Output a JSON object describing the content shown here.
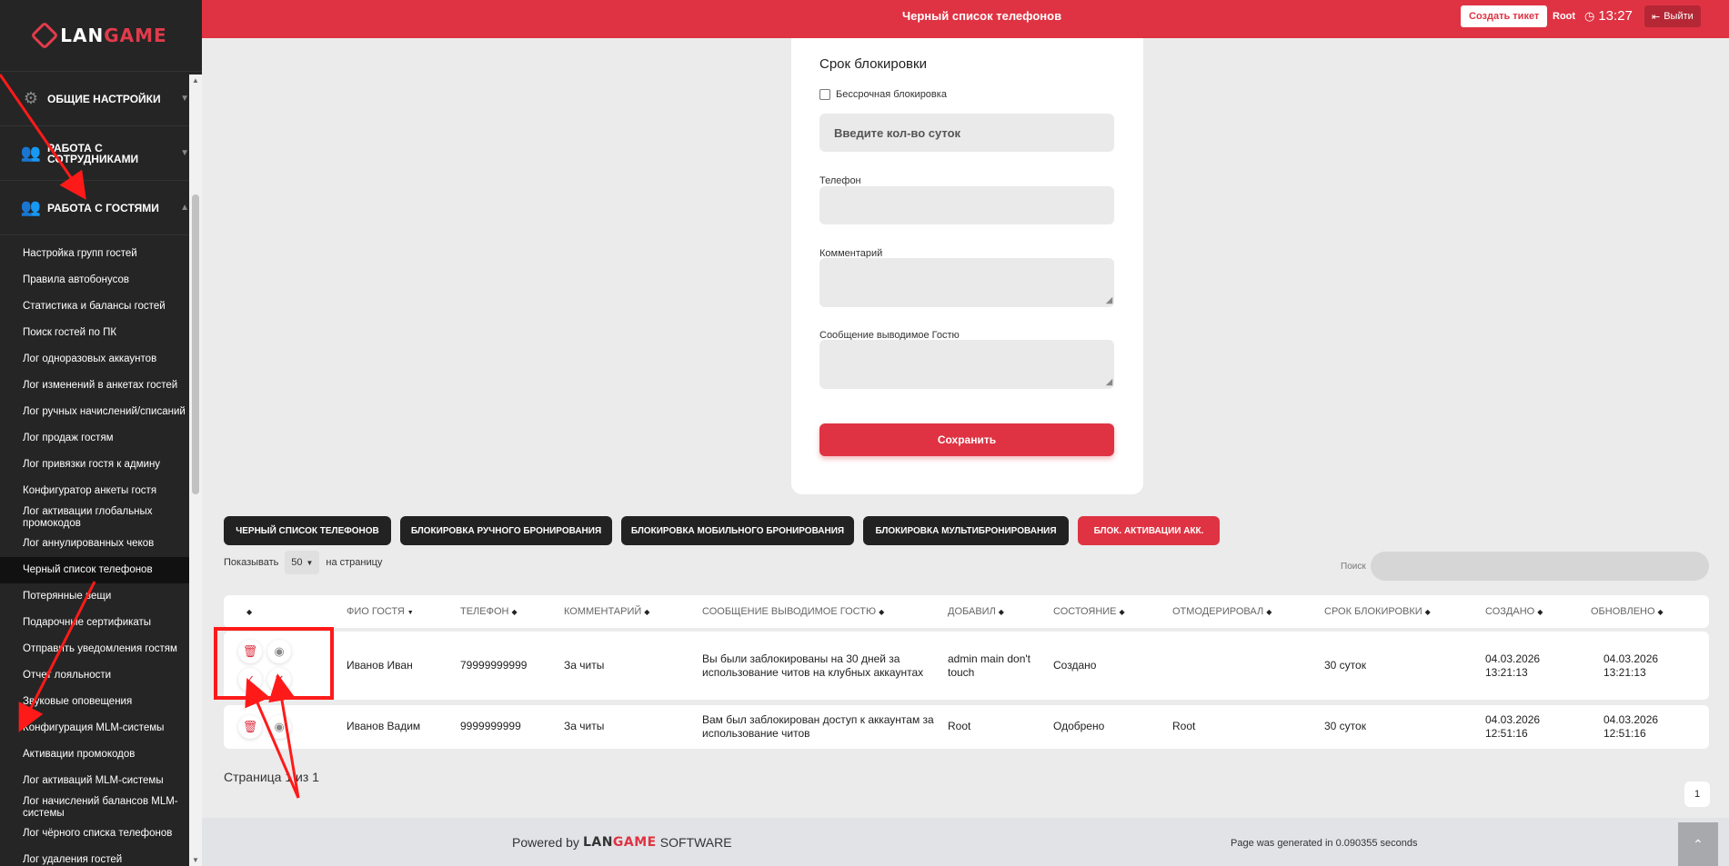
{
  "app": {
    "logo_main": "LAN",
    "logo_accent": "GAME"
  },
  "header": {
    "title": "Черный список телефонов",
    "ticket_button": "Создать тикет",
    "user": "Root",
    "time": "13:27",
    "logout": "Выйти"
  },
  "sidebar": {
    "sections": [
      {
        "label": "Общие настройки",
        "icon": "gear-icon"
      },
      {
        "label": "Работа с сотрудниками",
        "icon": "users-icon"
      },
      {
        "label": "Работа с гостями",
        "icon": "users-icon"
      }
    ],
    "items": [
      "Настройка групп гостей",
      "Правила автобонусов",
      "Статистика и балансы гостей",
      "Поиск гостей по ПК",
      "Лог одноразовых аккаунтов",
      "Лог изменений в анкетах гостей",
      "Лог ручных начислений/списаний",
      "Лог продаж гостям",
      "Лог привязки гостя к админу",
      "Конфигуратор анкеты гостя",
      "Лог активации глобальных промокодов",
      "Лог аннулированных чеков",
      "Черный список телефонов",
      "Потерянные вещи",
      "Подарочные сертификаты",
      "Отправить уведомления гостям",
      "Отчет лояльности",
      "Звуковые оповещения",
      "Конфигурация MLM-системы",
      "Активации промокодов",
      "Лог активаций MLM-системы",
      "Лог начислений балансов MLM-системы",
      "Лог чёрного списка телефонов",
      "Лог удаления гостей"
    ],
    "active_index": 12
  },
  "form": {
    "heading": "Срок блокировки",
    "checkbox_label": "Бессрочная блокировка",
    "days_placeholder": "Введите кол-во суток",
    "phone_label": "Телефон",
    "comment_label": "Комментарий",
    "message_label": "Сообщение выводимое Гостю",
    "save_button": "Сохранить"
  },
  "tabs": [
    {
      "label": "Черный список телефонов",
      "active": false
    },
    {
      "label": "Блокировка ручного бронирования",
      "active": false
    },
    {
      "label": "Блокировка мобильного бронирования",
      "active": false
    },
    {
      "label": "Блокировка мультибронирования",
      "active": false
    },
    {
      "label": "Блок. активации акк.",
      "active": true
    }
  ],
  "list_controls": {
    "show_label": "Показывать",
    "page_size": "50",
    "per_page_label": "на страницу",
    "search_label": "Поиск"
  },
  "table": {
    "columns": [
      "ФИО гостя",
      "Телефон",
      "Комментарий",
      "Сообщение выводимое Гостю",
      "Добавил",
      "Состояние",
      "Отмодерировал",
      "Срок блокировки",
      "Создано",
      "Обновлено"
    ],
    "rows": [
      {
        "name": "Иванов Иван",
        "phone": "79999999999",
        "comment": "За читы",
        "message": "Вы были заблокированы на 30 дней за использование читов на клубных аккаунтах",
        "added_by": "admin main don't touch",
        "status": "Создано",
        "moderator": "",
        "duration": "30 суток",
        "created_date": "04.03.2026",
        "created_time": "13:21:13",
        "updated_date": "04.03.2026",
        "updated_time": "13:21:13"
      },
      {
        "name": "Иванов Вадим",
        "phone": "9999999999",
        "comment": "За читы",
        "message": "Вам был заблокирован доступ к аккаунтам за использование читов",
        "added_by": "Root",
        "status": "Одобрено",
        "moderator": "Root",
        "duration": "30 суток",
        "created_date": "04.03.2026",
        "created_time": "12:51:16",
        "updated_date": "04.03.2026",
        "updated_time": "12:51:16"
      }
    ]
  },
  "pagination": {
    "info": "Страница 1 из 1",
    "current": "1"
  },
  "footer": {
    "powered_by": "Powered by",
    "brand_main": "LAN",
    "brand_accent": "GAME",
    "software": "SOFTWARE",
    "generated": "Page was generated in 0.090355 seconds"
  },
  "colors": {
    "accent": "#df3343",
    "sidebar": "#252525",
    "tab_dark": "#222222"
  }
}
